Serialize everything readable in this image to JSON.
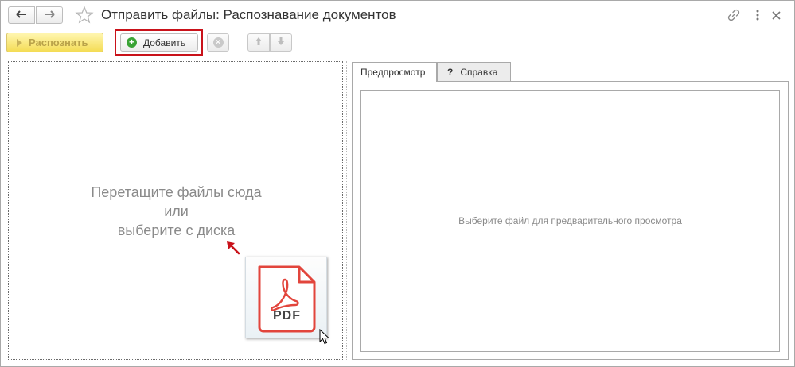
{
  "window": {
    "title": "Отправить файлы: Распознавание документов"
  },
  "titlebar": {
    "back_icon": "arrow-left-icon",
    "forward_icon": "arrow-right-icon",
    "favorite_icon": "star-icon",
    "link_icon": "link-icon",
    "more_icon": "vertical-ellipsis-icon",
    "close_icon": "close-icon"
  },
  "toolbar": {
    "recognize_label": "Распознать",
    "add_label": "Добавить",
    "delete_icon": "circle-x-icon",
    "move_up_icon": "arrow-up-icon",
    "move_down_icon": "arrow-down-icon"
  },
  "dropzone": {
    "line1": "Перетащите файлы сюда",
    "line2": "или",
    "line3": "выберите с диска",
    "file_icon_label": "PDF"
  },
  "tabs": [
    {
      "label": "Предпросмотр",
      "active": true
    },
    {
      "label": "Справка",
      "icon": "?",
      "active": false
    }
  ],
  "preview": {
    "placeholder": "Выберите файл для предварительного просмотра"
  },
  "colors": {
    "highlight_border": "#c9121a",
    "recognize_button": "#f4dc55",
    "add_icon": "#3aa335",
    "pdf_red": "#e2453c"
  }
}
